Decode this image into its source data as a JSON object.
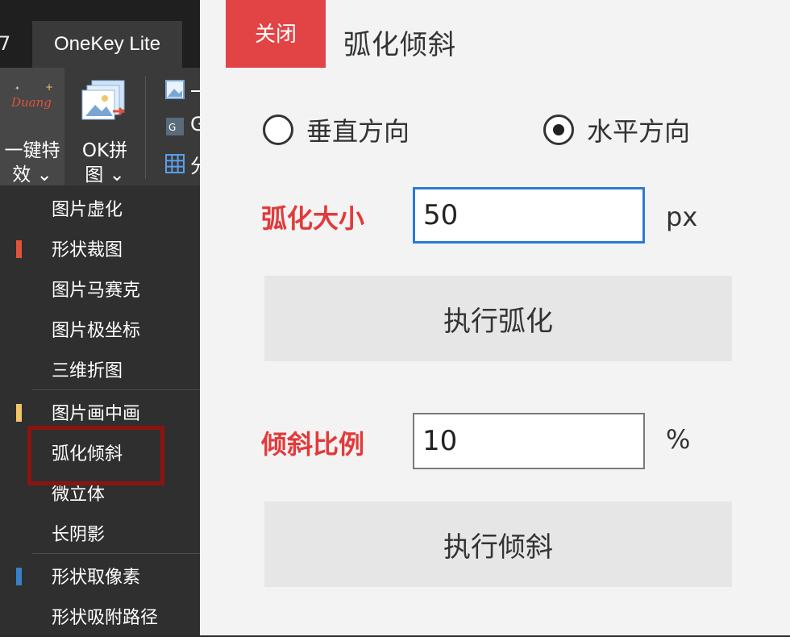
{
  "tabs": {
    "prev_partial": "7",
    "active": "OneKey Lite"
  },
  "ribbon": {
    "effects_button": {
      "label_line1": "一键特",
      "label_line2": "效 ⌄",
      "icon_text": "Duang"
    },
    "ok_button": {
      "label_line1": "OK拼",
      "label_line2": "图 ⌄"
    },
    "small_items": [
      "一",
      "G",
      "分"
    ]
  },
  "menu": {
    "items": [
      {
        "label": "图片虚化",
        "mark": ""
      },
      {
        "label": "形状裁图",
        "mark": "#e0533a"
      },
      {
        "label": "图片马赛克",
        "mark": ""
      },
      {
        "label": "图片极坐标",
        "mark": ""
      },
      {
        "label": "三维折图",
        "mark": ""
      },
      {
        "label": "图片画中画",
        "mark": "#f2c46a"
      },
      {
        "label": "弧化倾斜",
        "mark": ""
      },
      {
        "label": "微立体",
        "mark": ""
      },
      {
        "label": "长阴影",
        "mark": ""
      },
      {
        "label": "形状取像素",
        "mark": "#3a7fc8"
      },
      {
        "label": "形状吸附路径",
        "mark": ""
      }
    ]
  },
  "panel": {
    "close_label": "关闭",
    "title": "弧化倾斜",
    "direction": {
      "vertical_label": "垂直方向",
      "horizontal_label": "水平方向",
      "selected": "horizontal"
    },
    "arc": {
      "label": "弧化大小",
      "value": "50",
      "unit": "px",
      "button": "执行弧化"
    },
    "tilt": {
      "label": "倾斜比例",
      "value": "10",
      "unit": "%",
      "button": "执行倾斜"
    }
  },
  "colors": {
    "accent_red": "#e24446",
    "label_red": "#e23a3a",
    "focus_blue": "#2b7bd6"
  }
}
